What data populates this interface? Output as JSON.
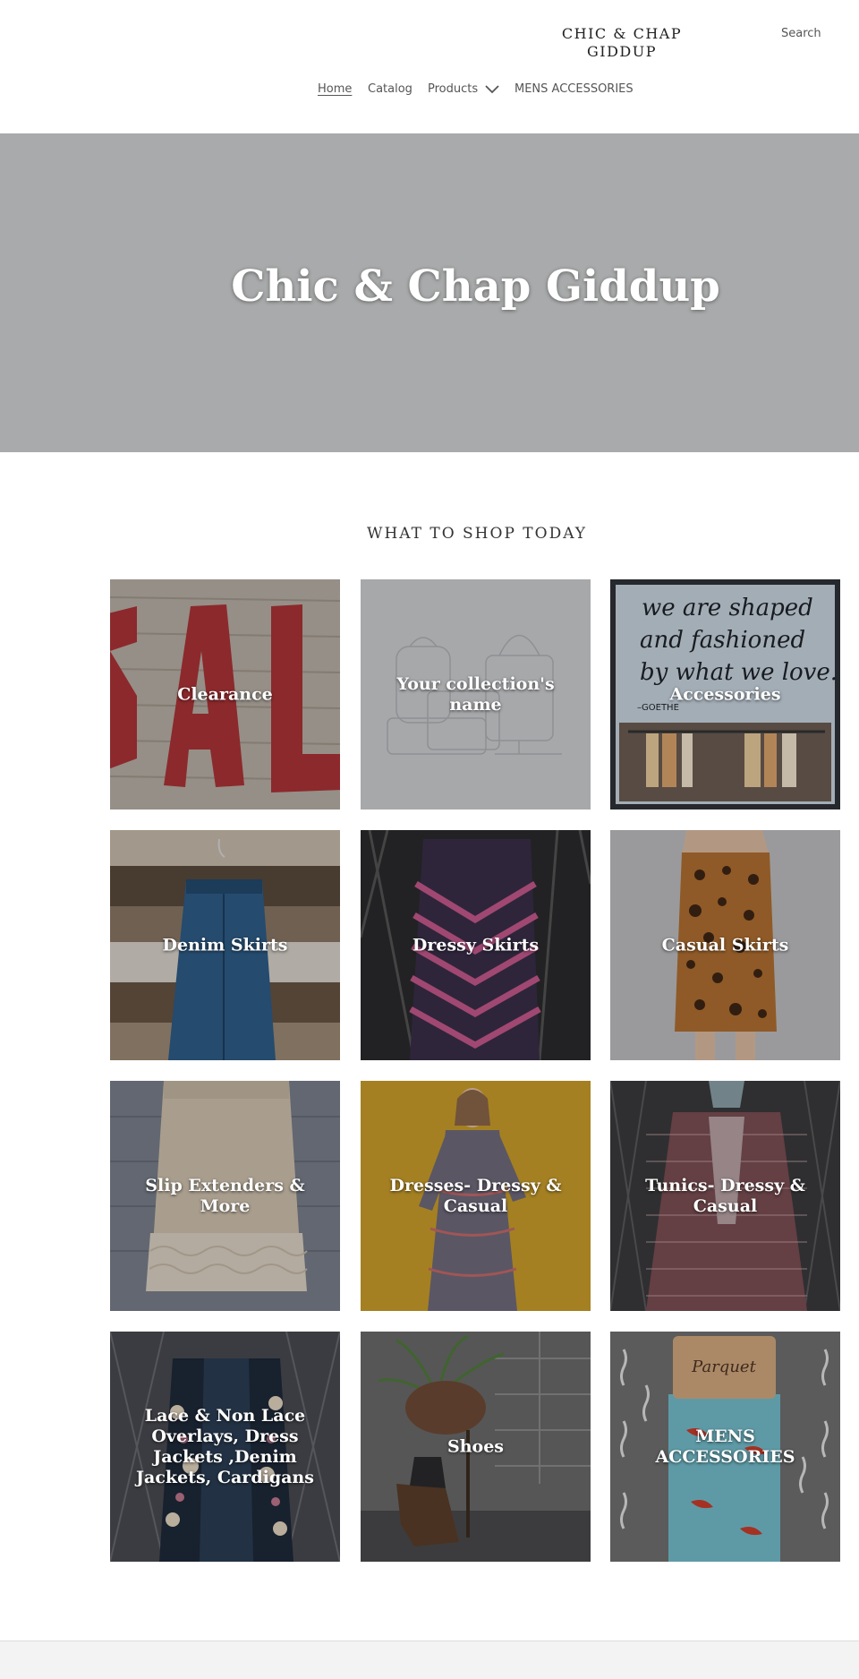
{
  "header": {
    "brand_line1": "CHIC & CHAP",
    "brand_line2": "GIDDUP",
    "search_label": "Search",
    "nav": [
      {
        "label": "Home",
        "active": true
      },
      {
        "label": "Catalog"
      },
      {
        "label": "Products",
        "has_dropdown": true
      },
      {
        "label": "MENS ACCESSORIES"
      }
    ]
  },
  "hero": {
    "title": "Chic & Chap Giddup",
    "background": "#a9aaab"
  },
  "collections": {
    "heading": "WHAT TO SHOP TODAY",
    "items": [
      {
        "label": "Clearance"
      },
      {
        "label": "Your collection's name"
      },
      {
        "label": "Accessories"
      },
      {
        "label": "Denim Skirts"
      },
      {
        "label": "Dressy Skirts"
      },
      {
        "label": "Casual Skirts"
      },
      {
        "label": "Slip Extenders & More"
      },
      {
        "label": "Dresses- Dressy & Casual"
      },
      {
        "label": "Tunics- Dressy & Casual"
      },
      {
        "label": "Lace & Non Lace Overlays, Dress Jackets ,Denim Jackets, Cardigans"
      },
      {
        "label": "Shoes"
      },
      {
        "label": "MENS ACCESSORIES"
      }
    ]
  },
  "image_text": {
    "quote_line1": "we are shaped",
    "quote_line2": "and fashioned",
    "quote_line3": "by what we love.",
    "quote_author": "–GOETHE",
    "sock_brand": "Parquet"
  }
}
